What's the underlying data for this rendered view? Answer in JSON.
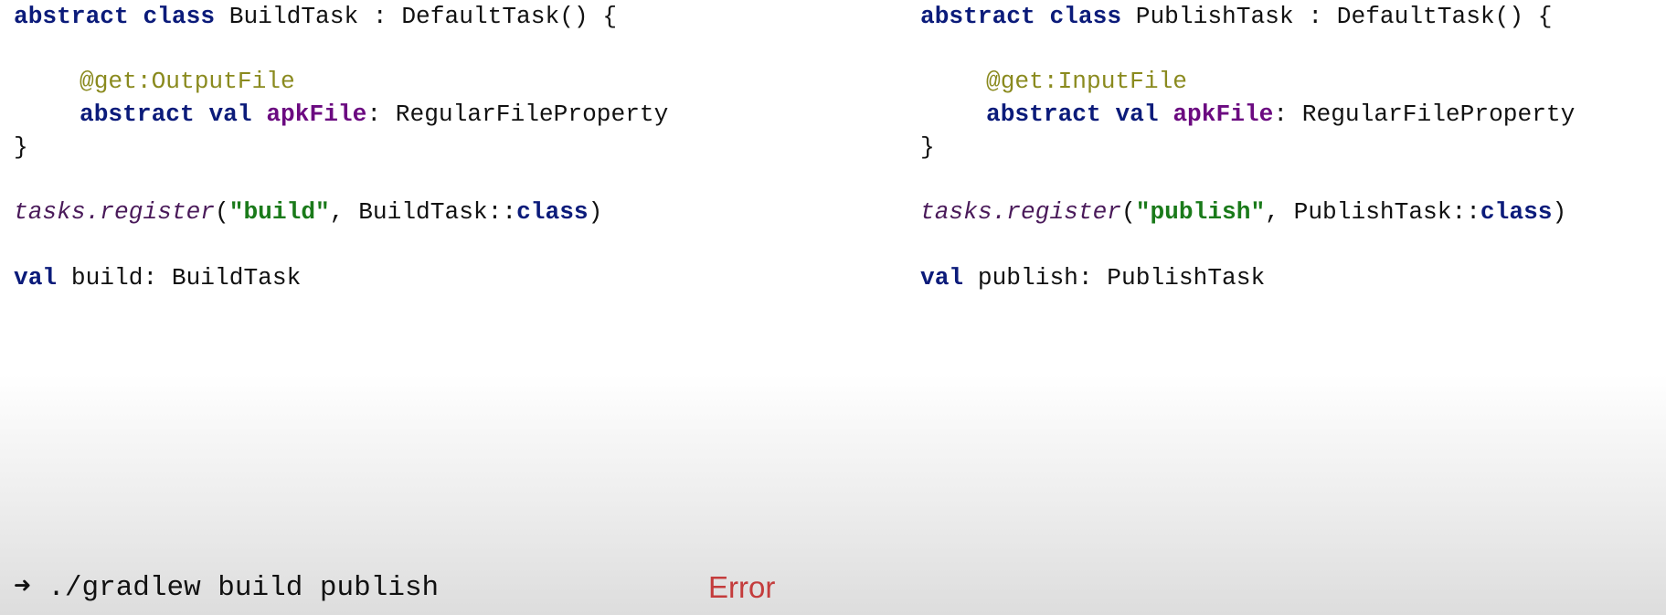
{
  "left_code": {
    "line1": {
      "kw_abstract": "abstract",
      "kw_class": "class",
      "rest": "BuildTask : DefaultTask() {"
    },
    "line2": {
      "annotation": "@get:OutputFile"
    },
    "line3": {
      "kw_abstract": "abstract",
      "kw_val": "val",
      "prop": "apkFile",
      "rest": ": RegularFileProperty"
    },
    "line4": {
      "brace": "}"
    },
    "line5": {
      "receiver": "tasks",
      "dot": ".",
      "fn": "register",
      "open": "(",
      "string": "\"build\"",
      "mid": ", BuildTask::",
      "kw_class": "class",
      "close": ")"
    },
    "line6": {
      "kw_val": "val",
      "rest": "build: BuildTask"
    }
  },
  "right_code": {
    "line1": {
      "kw_abstract": "abstract",
      "kw_class": "class",
      "rest": "PublishTask : DefaultTask() {"
    },
    "line2": {
      "annotation": "@get:InputFile"
    },
    "line3": {
      "kw_abstract": "abstract",
      "kw_val": "val",
      "prop": "apkFile",
      "rest": ": RegularFileProperty"
    },
    "line4": {
      "brace": "}"
    },
    "line5": {
      "receiver": "tasks",
      "dot": ".",
      "fn": "register",
      "open": "(",
      "string": "\"publish\"",
      "mid": ", PublishTask::",
      "kw_class": "class",
      "close": ")"
    },
    "line6": {
      "kw_val": "val",
      "rest": "publish: PublishTask"
    }
  },
  "terminal": {
    "prompt_arrow": "➜",
    "command": "./gradlew build publish"
  },
  "status": {
    "error_label": "Error"
  },
  "colors": {
    "keyword": "#0b1b7a",
    "property": "#6b0a80",
    "annotation": "#8a8a1e",
    "string": "#1a7a1a",
    "error": "#c43c3c"
  }
}
